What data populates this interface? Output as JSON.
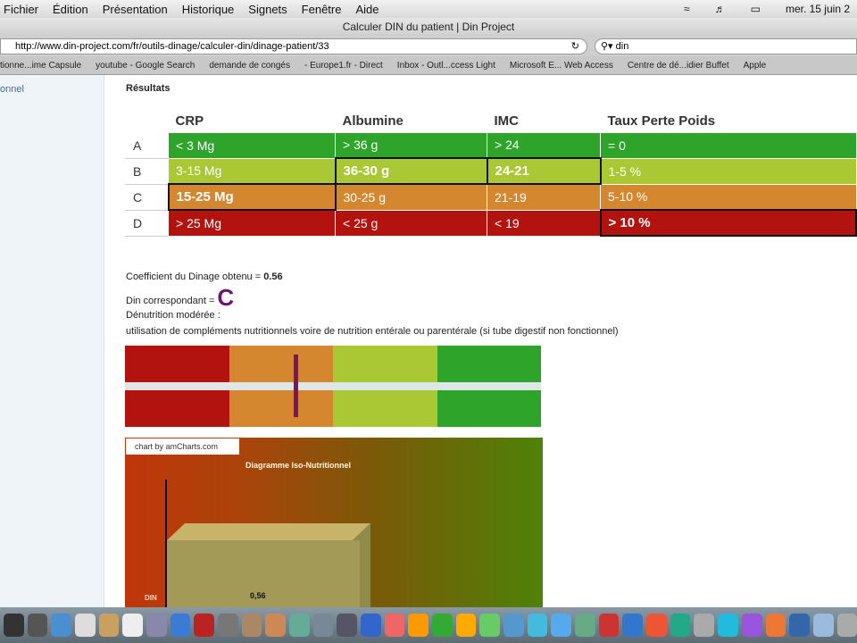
{
  "menubar": {
    "items": [
      "Fichier",
      "Édition",
      "Présentation",
      "Historique",
      "Signets",
      "Fenêtre",
      "Aide"
    ],
    "clock": "mer. 15 juin 2"
  },
  "browser": {
    "title": "Calculer DIN du patient | Din Project",
    "url": "http://www.din-project.com/fr/outils-dinage/calculer-din/dinage-patient/33",
    "search": "din",
    "bookmarks": [
      "tionne...ime Capsule",
      "youtube - Google Search",
      "demande de congés",
      "- Europe1.fr - Direct",
      "Inbox - Outl...ccess Light",
      "Microsoft E... Web Access",
      "Centre de dé...idier Buffet",
      "Apple"
    ]
  },
  "sidebar": {
    "link": "onnel"
  },
  "results": {
    "title": "Résultats",
    "headers": [
      "",
      "CRP",
      "Albumine",
      "IMC",
      "Taux Perte Poids"
    ],
    "rows": [
      {
        "label": "A",
        "cells": [
          "< 3 Mg",
          "> 36 g",
          "> 24",
          "= 0"
        ]
      },
      {
        "label": "B",
        "cells": [
          "3-15 Mg",
          "36-30 g",
          "24-21",
          "1-5 %"
        ]
      },
      {
        "label": "C",
        "cells": [
          "15-25 Mg",
          "30-25 g",
          "21-19",
          "5-10 %"
        ]
      },
      {
        "label": "D",
        "cells": [
          "> 25 Mg",
          "< 25 g",
          "< 19",
          "> 10 %"
        ]
      }
    ]
  },
  "summary": {
    "coef_label": "Coefficient du Dinage obtenu = ",
    "coef": "0.56",
    "din_label": "Din correspondant = ",
    "din": "C",
    "status": "Dénutrition modérée :",
    "advice": "utilisation de compléments nutritionnels voire de nutrition entérale ou parentérale (si tube digestif non fonctionnel)"
  },
  "gauge": {
    "colors": [
      "#b3130f",
      "#d4872e",
      "#a9c834",
      "#2ea52a"
    ],
    "marker_position": 0.41
  },
  "chart": {
    "credit": "chart by amCharts.com",
    "title": "Diagramme Iso-Nutritionnel",
    "category": "DIN",
    "value": "0,56"
  }
}
